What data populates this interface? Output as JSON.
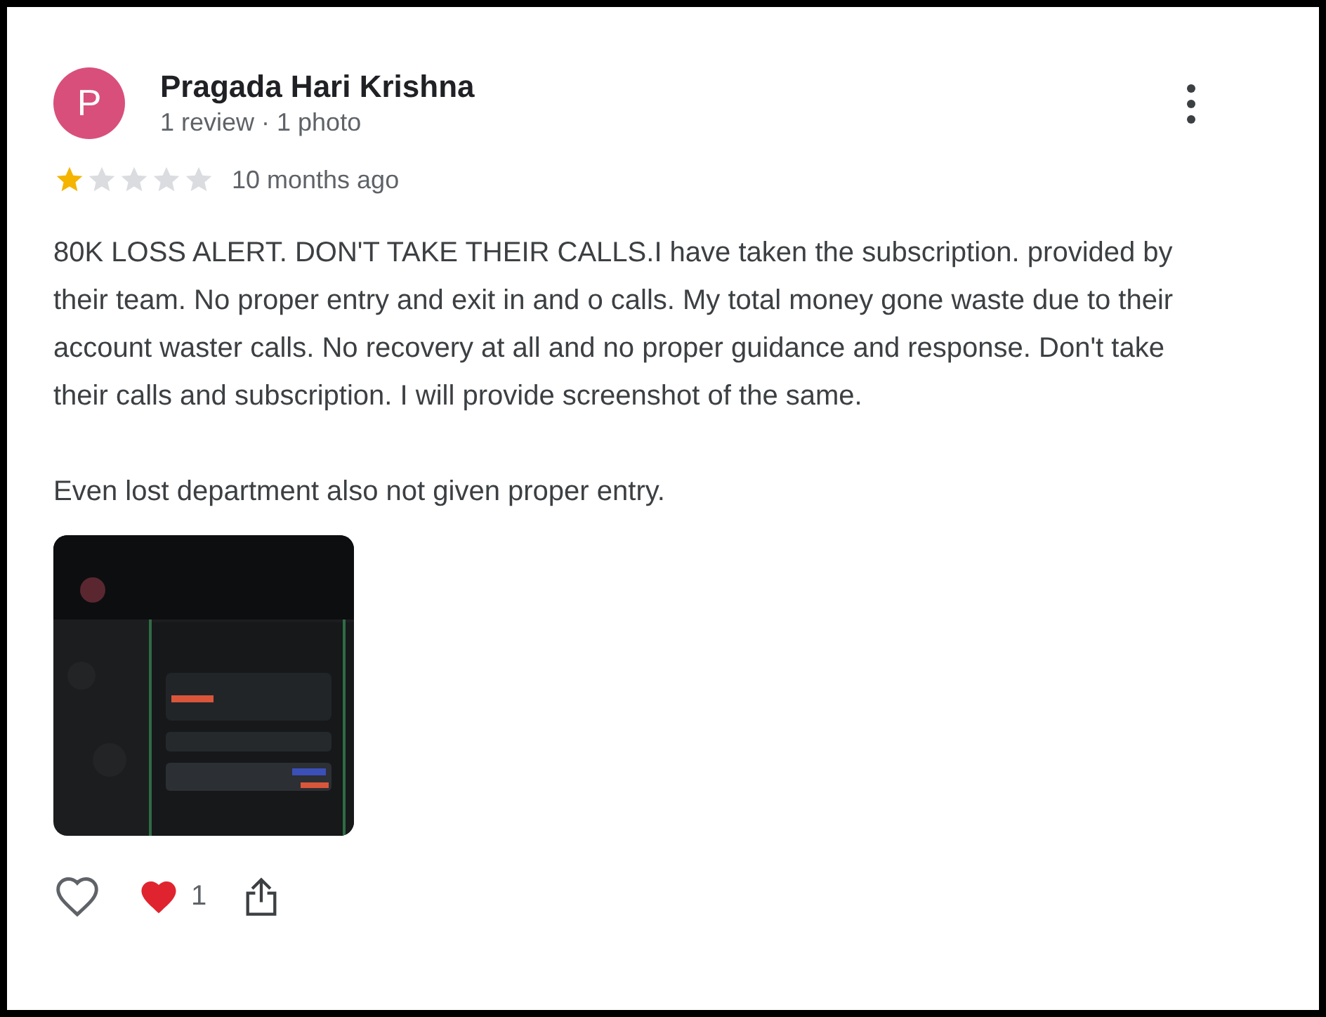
{
  "reviewer": {
    "initial": "P",
    "name": "Pragada Hari Krishna",
    "meta": "1 review · 1 photo"
  },
  "rating": {
    "stars": 1,
    "time": "10 months ago"
  },
  "paragraphs": [
    "80K LOSS ALERT. DON'T TAKE THEIR CALLS.I have taken the subscription. provided by their team. No proper entry and exit in and o calls. My total money gone waste due to their account waster calls. No recovery at all and no proper guidance and response. Don't take their calls and subscription. I will provide screenshot of the same.",
    "Even lost department also not given proper entry."
  ],
  "reactions": {
    "love_count": "1"
  }
}
